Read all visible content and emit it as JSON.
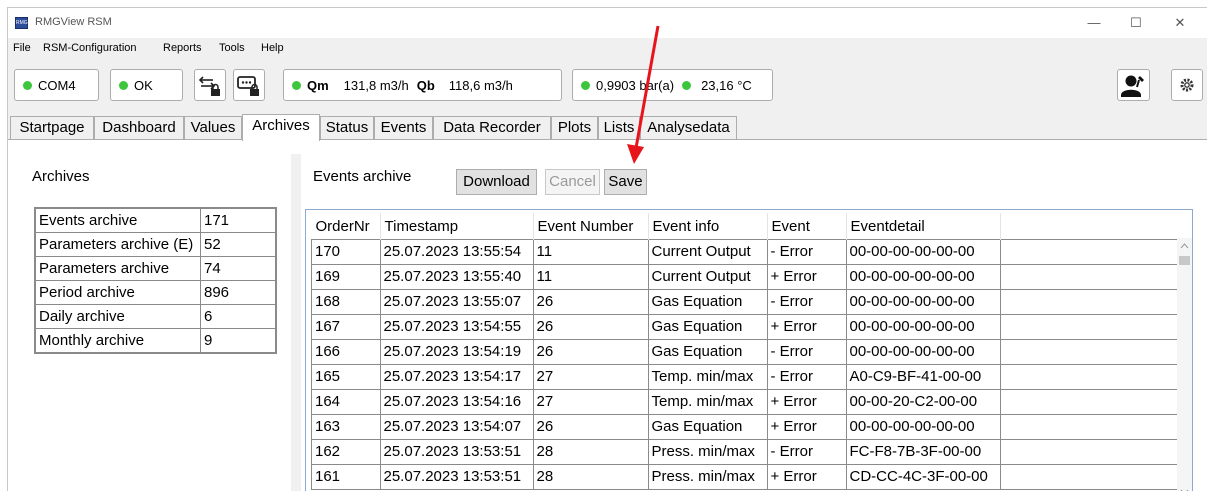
{
  "window": {
    "title": "RMGView RSM",
    "controls": [
      "—",
      "☐",
      "✕"
    ]
  },
  "menu": [
    "File",
    "RSM-Configuration",
    "Reports",
    "Tools",
    "Help"
  ],
  "status": {
    "com": "COM4",
    "ok": "OK",
    "qm_label": "Qm",
    "qm_value": "131,8 m3/h",
    "qb_label": "Qb",
    "qb_value": "118,6 m3/h",
    "pressure": "0,9903 bar(a)",
    "temperature": "23,16 °C",
    "green": "#3cc63c"
  },
  "tabs": [
    "Startpage",
    "Dashboard",
    "Values",
    "Archives",
    "Status",
    "Events",
    "Data Recorder",
    "Plots",
    "Lists",
    "Analysedata"
  ],
  "active_tab": "Archives",
  "archives": {
    "title": "Archives",
    "rows": [
      {
        "name": "Events archive",
        "count": "171"
      },
      {
        "name": "Parameters archive (E)",
        "count": "52"
      },
      {
        "name": "Parameters archive",
        "count": "74"
      },
      {
        "name": "Period archive",
        "count": "896"
      },
      {
        "name": "Daily archive",
        "count": "6"
      },
      {
        "name": "Monthly archive",
        "count": "9"
      }
    ]
  },
  "events": {
    "title": "Events archive",
    "download_label": "Download",
    "cancel_label": "Cancel",
    "save_label": "Save",
    "columns": [
      "OrderNr",
      "Timestamp",
      "Event Number",
      "Event info",
      "Event",
      "Eventdetail"
    ],
    "rows": [
      [
        "170",
        "25.07.2023 13:55:54",
        "11",
        "Current Output",
        "- Error",
        "00-00-00-00-00-00"
      ],
      [
        "169",
        "25.07.2023 13:55:40",
        "11",
        "Current Output",
        "+ Error",
        "00-00-00-00-00-00"
      ],
      [
        "168",
        "25.07.2023 13:55:07",
        "26",
        "Gas Equation",
        "- Error",
        "00-00-00-00-00-00"
      ],
      [
        "167",
        "25.07.2023 13:54:55",
        "26",
        "Gas Equation",
        "+ Error",
        "00-00-00-00-00-00"
      ],
      [
        "166",
        "25.07.2023 13:54:19",
        "26",
        "Gas Equation",
        "- Error",
        "00-00-00-00-00-00"
      ],
      [
        "165",
        "25.07.2023 13:54:17",
        "27",
        "Temp. min/max",
        "- Error",
        "A0-C9-BF-41-00-00"
      ],
      [
        "164",
        "25.07.2023 13:54:16",
        "27",
        "Temp. min/max",
        "+ Error",
        "00-00-20-C2-00-00"
      ],
      [
        "163",
        "25.07.2023 13:54:07",
        "26",
        "Gas Equation",
        "+ Error",
        "00-00-00-00-00-00"
      ],
      [
        "162",
        "25.07.2023 13:53:51",
        "28",
        "Press. min/max",
        "- Error",
        "FC-F8-7B-3F-00-00"
      ],
      [
        "161",
        "25.07.2023 13:53:51",
        "28",
        "Press. min/max",
        "+ Error",
        "CD-CC-4C-3F-00-00"
      ]
    ]
  },
  "annotation_color": "#e8141c"
}
